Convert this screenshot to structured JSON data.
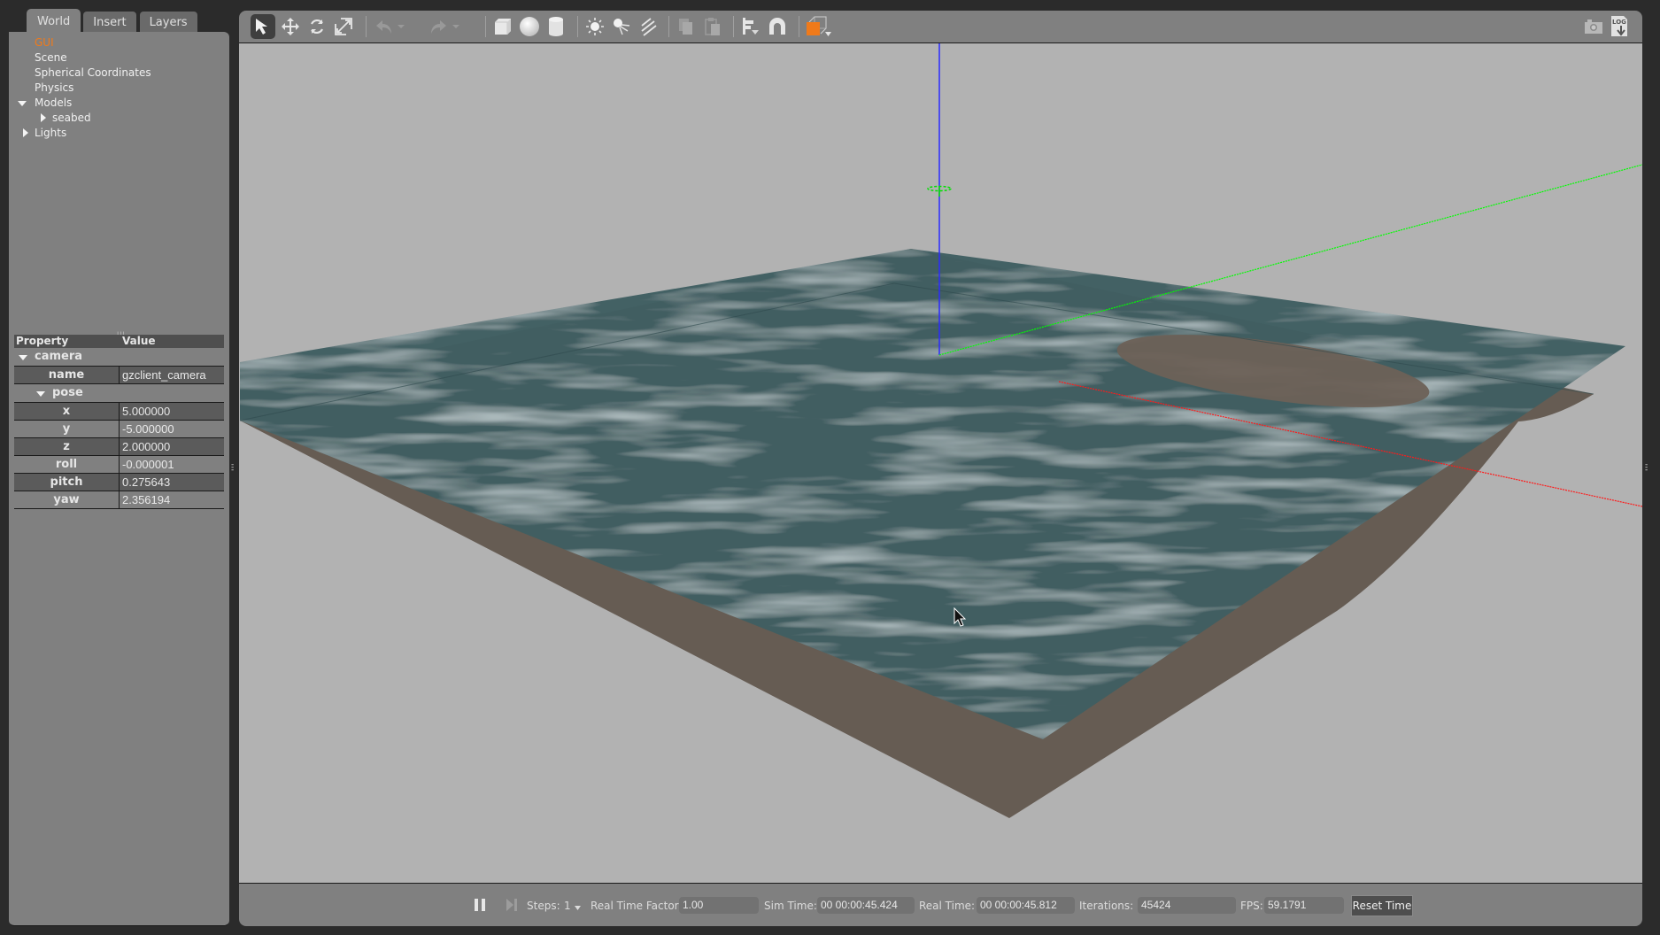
{
  "tabs": [
    {
      "label": "World",
      "active": true
    },
    {
      "label": "Insert",
      "active": false
    },
    {
      "label": "Layers",
      "active": false
    }
  ],
  "world_tree": [
    {
      "label": "GUI",
      "selected": true,
      "expander": "none",
      "depth": 1
    },
    {
      "label": "Scene",
      "selected": false,
      "expander": "none",
      "depth": 1
    },
    {
      "label": "Spherical Coordinates",
      "selected": false,
      "expander": "none",
      "depth": 1
    },
    {
      "label": "Physics",
      "selected": false,
      "expander": "none",
      "depth": 1
    },
    {
      "label": "Models",
      "selected": false,
      "expander": "expanded",
      "depth": 1
    },
    {
      "label": "seabed",
      "selected": false,
      "expander": "collapsed",
      "depth": 2
    },
    {
      "label": "Lights",
      "selected": false,
      "expander": "collapsed",
      "depth": 1
    }
  ],
  "properties": {
    "header": {
      "property": "Property",
      "value": "Value"
    },
    "group": "camera",
    "name_row": {
      "key": "name",
      "value": "gzclient_camera"
    },
    "subgroup": "pose",
    "pose": [
      {
        "key": "x",
        "value": "5.000000"
      },
      {
        "key": "y",
        "value": "-5.000000"
      },
      {
        "key": "z",
        "value": "2.000000"
      },
      {
        "key": "roll",
        "value": "-0.000001"
      },
      {
        "key": "pitch",
        "value": "0.275643"
      },
      {
        "key": "yaw",
        "value": "2.356194"
      }
    ]
  },
  "toolbar": {
    "tools": [
      {
        "icon": "select-arrow-icon",
        "active": true
      },
      {
        "icon": "translate-icon"
      },
      {
        "icon": "rotate-icon"
      },
      {
        "icon": "scale-icon"
      },
      {
        "icon": "undo-icon",
        "disabled": true
      },
      {
        "icon": "undo-history-icon",
        "disabled": true
      },
      {
        "icon": "redo-icon",
        "disabled": true
      },
      {
        "icon": "redo-history-icon",
        "disabled": true
      },
      {
        "icon": "box-shape-icon"
      },
      {
        "icon": "sphere-shape-icon"
      },
      {
        "icon": "cylinder-shape-icon"
      },
      {
        "icon": "point-light-icon"
      },
      {
        "icon": "spot-light-icon"
      },
      {
        "icon": "directional-light-icon"
      },
      {
        "icon": "copy-icon",
        "disabled": true
      },
      {
        "icon": "paste-icon",
        "disabled": true
      },
      {
        "icon": "align-icon"
      },
      {
        "icon": "snap-magnet-icon"
      },
      {
        "icon": "view-angle-icon"
      },
      {
        "icon": "screenshot-camera-icon"
      },
      {
        "icon": "log-record-icon"
      }
    ],
    "log_label": "LOG"
  },
  "scene": {
    "colors": {
      "background": "#b2b2b2",
      "water": "#3f5f62",
      "seabed": "#665c53",
      "x_axis": "#ff0000",
      "y_axis": "#00ff00",
      "z_axis": "#0000ff"
    }
  },
  "bottom_bar": {
    "steps_label": "Steps:",
    "steps_value": "1",
    "rtf_label": "Real Time Factor:",
    "rtf_value": "1.00",
    "sim_time_label": "Sim Time:",
    "sim_time_value": "00 00:00:45.424",
    "real_time_label": "Real Time:",
    "real_time_value": "00 00:00:45.812",
    "iterations_label": "Iterations:",
    "iterations_value": "45424",
    "fps_label": "FPS:",
    "fps_value": "59.1791",
    "reset_label": "Reset Time"
  }
}
